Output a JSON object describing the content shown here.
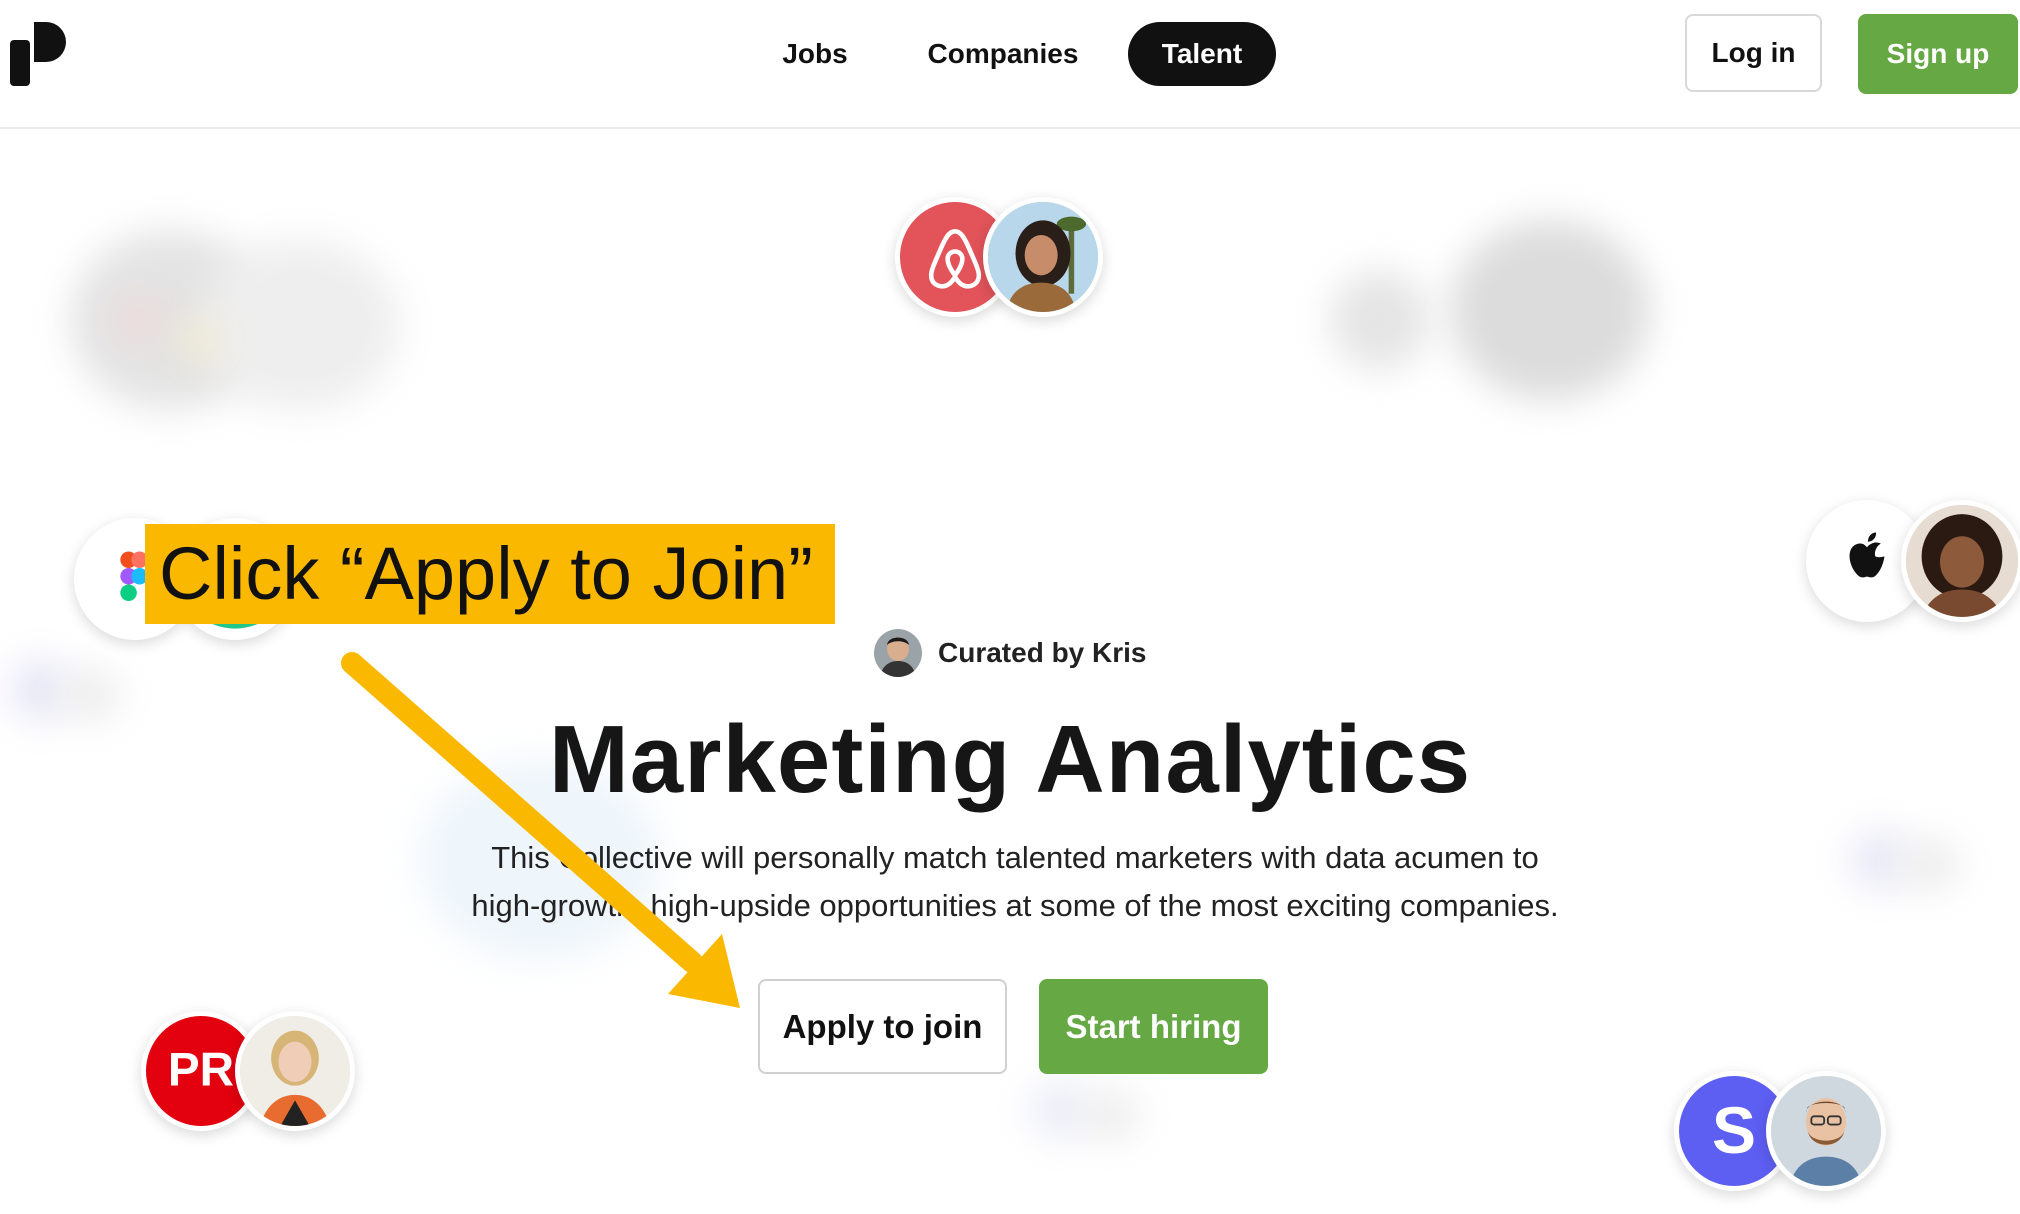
{
  "nav": {
    "logo_name": "p-logo-icon",
    "links": [
      {
        "label": "Jobs"
      },
      {
        "label": "Companies"
      },
      {
        "label": "Talent",
        "active": true
      }
    ],
    "login_label": "Log in",
    "signup_label": "Sign up"
  },
  "hero": {
    "curated_by": "Curated by Kris",
    "title": "Marketing Analytics",
    "description_line1": "This Collective will personally match talented marketers with data acumen to",
    "description_line2": "high-growth, high-upside opportunities at some of the most exciting companies.",
    "apply_label": "Apply to join",
    "hire_label": "Start hiring"
  },
  "company_pairs": [
    {
      "company_icon": "airbnb-icon",
      "person": "person-avatar"
    },
    {
      "company_icon": "figma-icon",
      "person": "company-badge"
    },
    {
      "company_icon": "apple-icon",
      "person": "person-avatar"
    },
    {
      "company_icon": "pr-logo-icon",
      "company_text": "PR",
      "person": "person-avatar"
    },
    {
      "company_icon": "s-logo-icon",
      "company_text": "S",
      "person": "person-avatar"
    }
  ],
  "annotation": {
    "callout_text": "Click “Apply to Join”"
  },
  "colors": {
    "brand_green": "#65a844",
    "nav_active_bg": "#111111",
    "callout_yellow": "#fbb800",
    "airbnb_red": "#e2535a",
    "pr_red": "#e3000f",
    "s_purple": "#5d5ef2"
  }
}
